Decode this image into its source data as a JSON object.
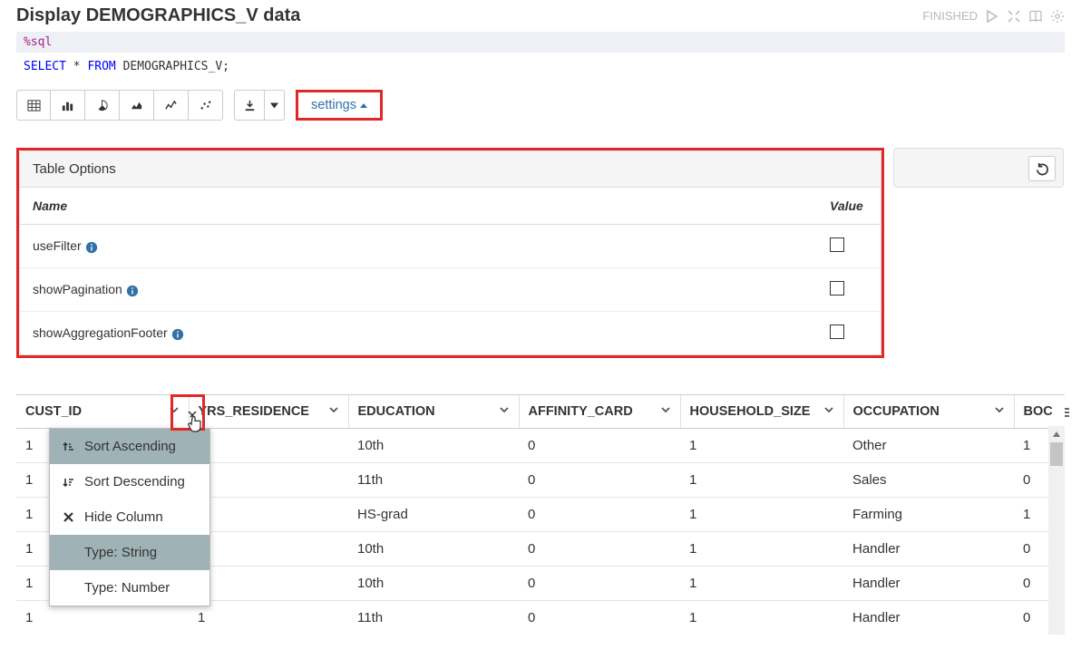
{
  "header": {
    "title": "Display DEMOGRAPHICS_V data",
    "status": "FINISHED"
  },
  "code": {
    "magic": "%sql",
    "select": "SELECT",
    "star": " * ",
    "from": "FROM",
    "rest": " DEMOGRAPHICS_V;"
  },
  "toolbar": {
    "settings_label": "settings"
  },
  "options_panel": {
    "title": "Table Options",
    "name_header": "Name",
    "value_header": "Value",
    "rows": [
      {
        "label": "useFilter"
      },
      {
        "label": "showPagination"
      },
      {
        "label": "showAggregationFooter"
      }
    ]
  },
  "data_table": {
    "columns": [
      "CUST_ID",
      "YRS_RESIDENCE",
      "EDUCATION",
      "AFFINITY_CARD",
      "HOUSEHOLD_SIZE",
      "OCCUPATION",
      "BOC"
    ],
    "rows": [
      {
        "education": "10th",
        "affinity": "0",
        "household": "1",
        "occupation": "Other",
        "boc": "1"
      },
      {
        "education": "11th",
        "affinity": "0",
        "household": "1",
        "occupation": "Sales",
        "boc": "0"
      },
      {
        "education": "HS-grad",
        "affinity": "0",
        "household": "1",
        "occupation": "Farming",
        "boc": "1"
      },
      {
        "education": "10th",
        "affinity": "0",
        "household": "1",
        "occupation": "Handler",
        "boc": "0"
      },
      {
        "education": "10th",
        "affinity": "0",
        "household": "1",
        "occupation": "Handler",
        "boc": "0"
      },
      {
        "education": "11th",
        "affinity": "0",
        "household": "1",
        "occupation": "Handler",
        "boc": "0"
      }
    ],
    "row_prefix_a": "1",
    "row_prefix_b": "1"
  },
  "ctx_menu": {
    "sort_asc": "Sort Ascending",
    "sort_desc": "Sort Descending",
    "hide_col": "Hide Column",
    "type_string": "Type: String",
    "type_number": "Type: Number"
  }
}
